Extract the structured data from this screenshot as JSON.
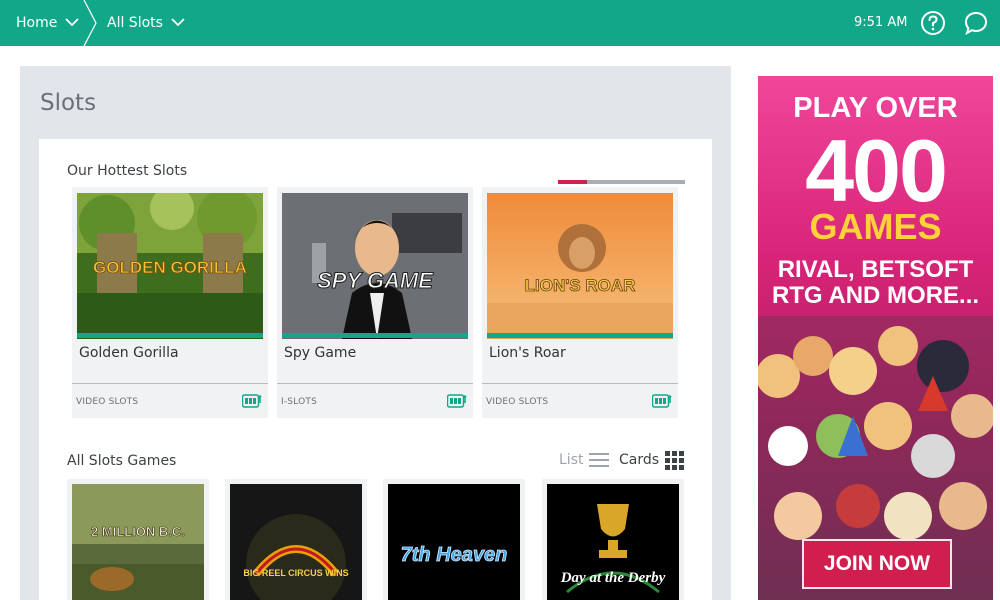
{
  "topbar": {
    "breadcrumb": [
      {
        "label": "Home",
        "icon": "chevron-down-icon"
      },
      {
        "label": "All Slots",
        "icon": "chevron-down-icon"
      }
    ],
    "time": "9:51 AM",
    "icons": [
      "help-icon",
      "chat-icon"
    ],
    "color": "#11a88a"
  },
  "page": {
    "title": "Slots"
  },
  "hottest": {
    "title": "Our Hottest Slots",
    "cards": [
      {
        "name": "Golden Gorilla",
        "category": "VIDEO SLOTS",
        "art_text": "GOLDEN GORILLA"
      },
      {
        "name": "Spy Game",
        "category": "I-SLOTS",
        "art_text": "SPY GAME"
      },
      {
        "name": "Lion's Roar",
        "category": "VIDEO SLOTS",
        "art_text": "LION'S ROAR"
      }
    ]
  },
  "all_games": {
    "title": "All Slots Games",
    "view_list_label": "List",
    "view_cards_label": "Cards",
    "active_view": "Cards",
    "games": [
      {
        "art_text": "2 MILLION B.C."
      },
      {
        "art_text": "BIG REEL CIRCUS WINS"
      },
      {
        "art_text": "7th Heaven"
      },
      {
        "art_text": "Day at the Derby"
      }
    ]
  },
  "ad": {
    "line1": "PLAY OVER",
    "line2": "400",
    "line3": "GAMES",
    "line4": "RIVAL, BETSOFT",
    "line5": "RTG AND MORE...",
    "button": "JOIN NOW",
    "accent": "#d21d4f"
  }
}
